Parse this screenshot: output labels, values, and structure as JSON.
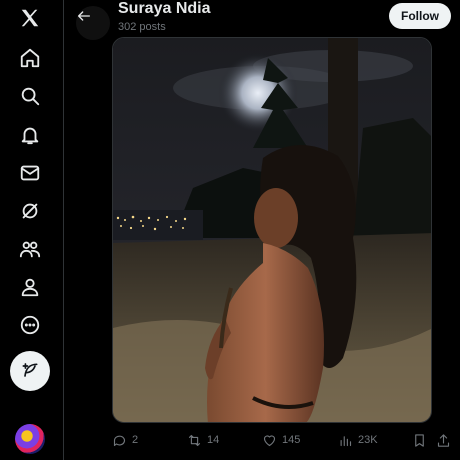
{
  "nav": {
    "items": [
      {
        "name": "x-logo-icon"
      },
      {
        "name": "home-icon"
      },
      {
        "name": "search-icon"
      },
      {
        "name": "notifications-icon"
      },
      {
        "name": "messages-icon"
      },
      {
        "name": "grok-icon"
      },
      {
        "name": "communities-icon"
      },
      {
        "name": "profile-icon"
      },
      {
        "name": "more-icon"
      }
    ],
    "compose_icon": "feather-plus-icon"
  },
  "header": {
    "display_name": "Suraya Ndia",
    "post_count": "302 posts",
    "follow_label": "Follow"
  },
  "media": {
    "type": "photo"
  },
  "actions": {
    "reply_count": "2",
    "repost_count": "14",
    "like_count": "145",
    "views_count": "23K"
  },
  "colors": {
    "background": "#000000",
    "text_primary": "#e7e9ea",
    "text_secondary": "#71767b",
    "follow_bg": "#eff3f4",
    "border": "#2f3336"
  }
}
